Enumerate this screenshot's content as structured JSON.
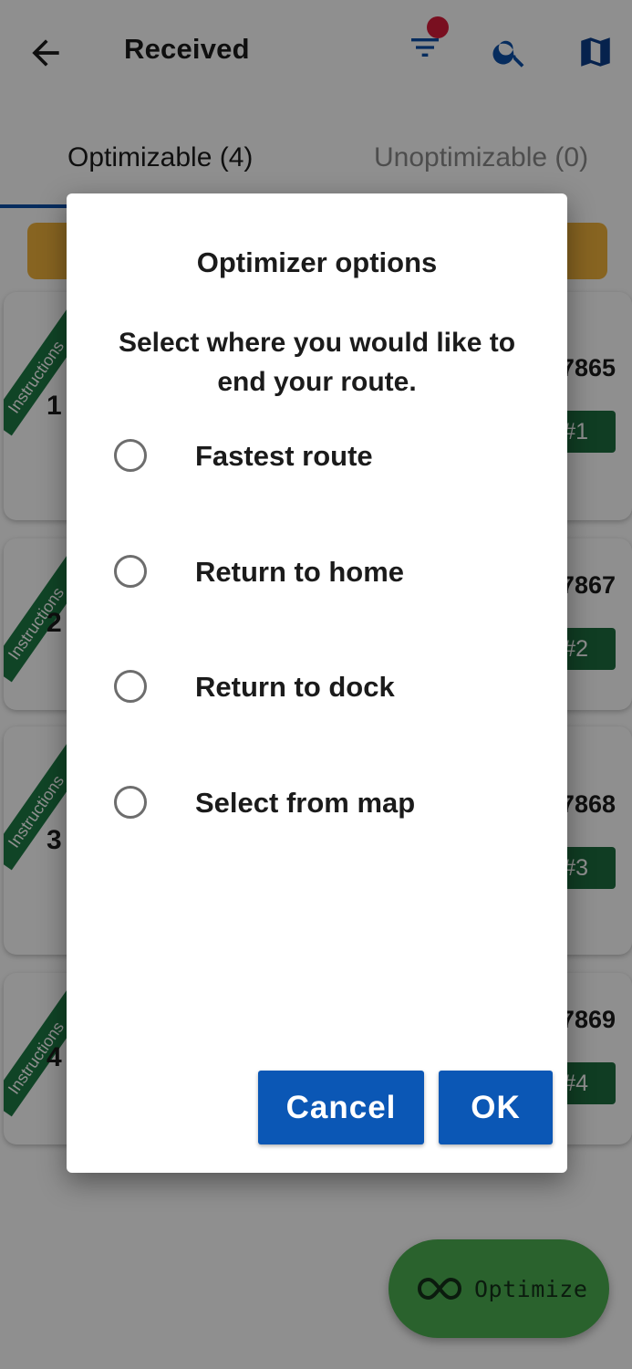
{
  "appbar": {
    "title": "Received",
    "icons": [
      "arrow-back-icon",
      "filter-icon",
      "search-icon",
      "map-icon"
    ],
    "filter_badge_color": "#d81b3a"
  },
  "tabs": [
    {
      "label": "Optimizable (4)",
      "selected": true
    },
    {
      "label": "Unoptimizable (0)",
      "selected": false
    }
  ],
  "stops": [
    {
      "number": "1",
      "ribbon": "Instructions",
      "order_fragment": "7865",
      "badge": "#1"
    },
    {
      "number": "2",
      "ribbon": "Instructions",
      "order_fragment": "7867",
      "badge": "#2"
    },
    {
      "number": "3",
      "ribbon": "Instructions",
      "order_fragment": "7868",
      "badge": "#3"
    },
    {
      "number": "4",
      "ribbon": "Instructions",
      "order_fragment": "7869",
      "badge": "#4"
    }
  ],
  "fab": {
    "label": "Optimize",
    "icon": "infinity-icon",
    "color": "#4caf50"
  },
  "dialog": {
    "title": "Optimizer options",
    "message": "Select where you would like to end your route.",
    "options": [
      {
        "label": "Fastest route",
        "selected": false
      },
      {
        "label": "Return to home",
        "selected": false
      },
      {
        "label": "Return to dock",
        "selected": false
      },
      {
        "label": "Select from map",
        "selected": false
      }
    ],
    "cancel_label": "Cancel",
    "ok_label": "OK",
    "button_color": "#0b57b5"
  }
}
